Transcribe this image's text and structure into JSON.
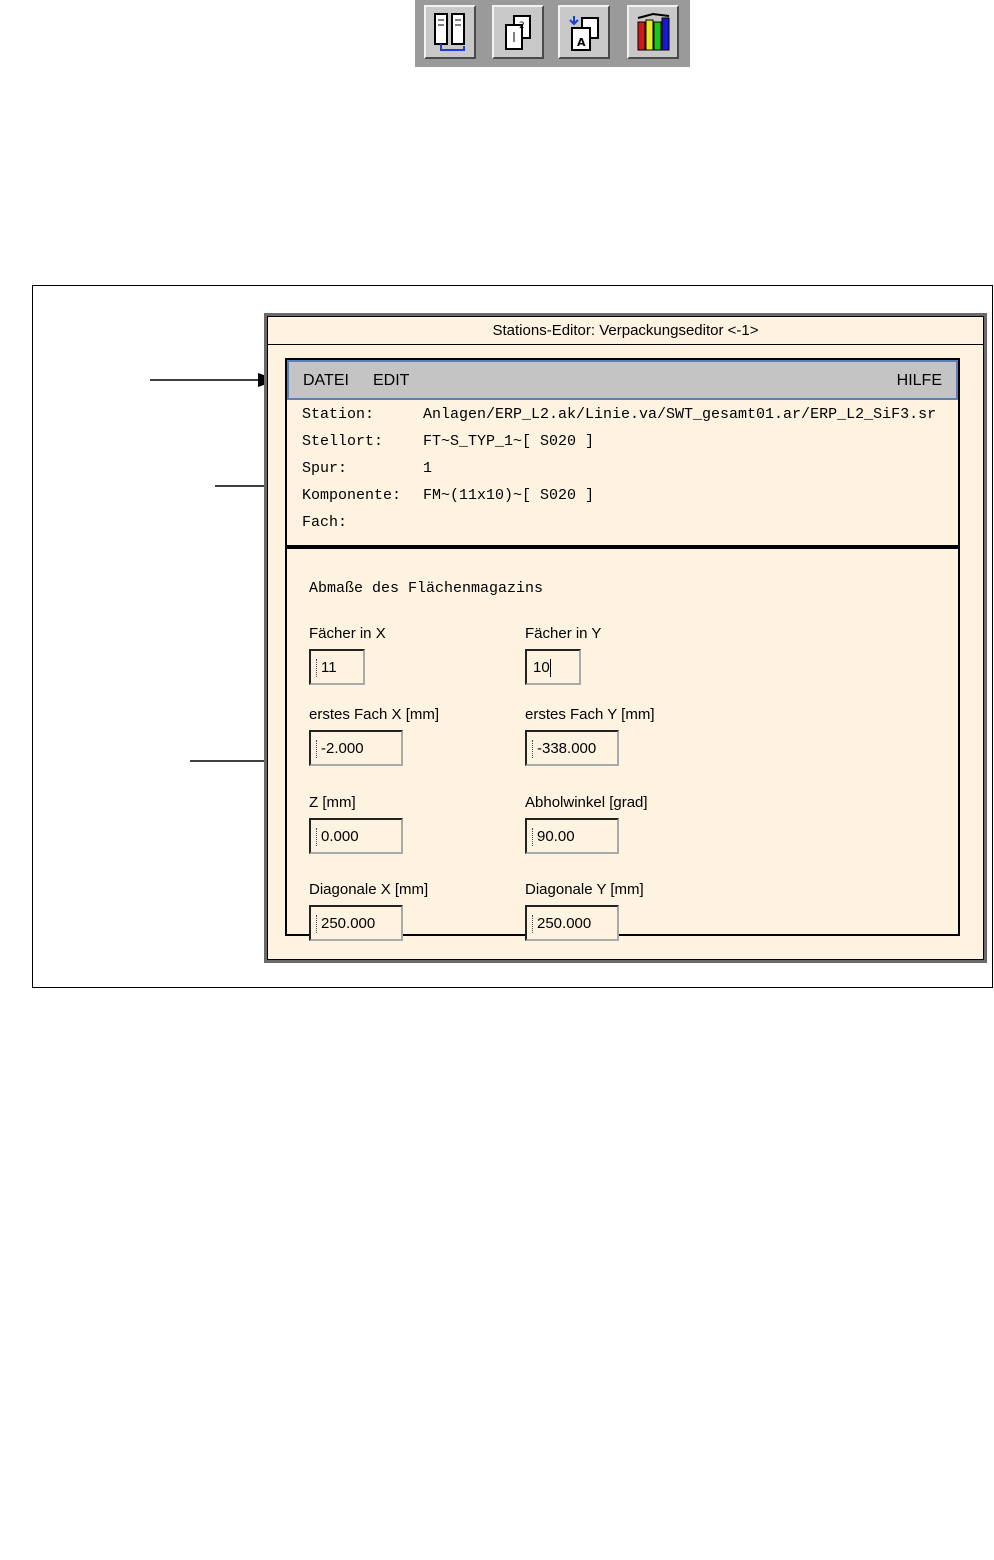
{
  "toolbar": {
    "buttons": [
      {
        "icon": "split-compare-icon"
      },
      {
        "icon": "document-copy-icon"
      },
      {
        "icon": "document-arrow-icon"
      },
      {
        "icon": "books-icon"
      }
    ]
  },
  "window": {
    "title": "Stations-Editor: Verpackungseditor <-1>",
    "menu": {
      "datei": "DATEI",
      "edit": "EDIT",
      "hilfe": "HILFE"
    },
    "info": {
      "station_label": "Station:",
      "station_value": "Anlagen/ERP_L2.ak/Linie.va/SWT_gesamt01.ar/ERP_L2_SiF3.sr",
      "stellort_label": "Stellort:",
      "stellort_value": "FT~S_TYP_1~[ S020 ]",
      "spur_label": "Spur:",
      "spur_value": "1",
      "komponente_label": "Komponente:",
      "komponente_value": "FM~(11x10)~[ S020 ]",
      "fach_label": "Fach:"
    },
    "section_title": "Abmaße des Flächenmagazins",
    "fields": {
      "faecher_x_label": "Fächer in X",
      "faecher_x_value": "11",
      "faecher_y_label": "Fächer in Y",
      "faecher_y_value": "10",
      "erstes_fach_x_label": "erstes Fach X [mm]",
      "erstes_fach_x_value": "-2.000",
      "erstes_fach_y_label": "erstes Fach Y [mm]",
      "erstes_fach_y_value": "-338.000",
      "z_label": "Z [mm]",
      "z_value": "0.000",
      "abholwinkel_label": "Abholwinkel [grad]",
      "abholwinkel_value": "90.00",
      "diagonale_x_label": "Diagonale X [mm]",
      "diagonale_x_value": "250.000",
      "diagonale_y_label": "Diagonale Y [mm]",
      "diagonale_y_value": "250.000"
    }
  }
}
